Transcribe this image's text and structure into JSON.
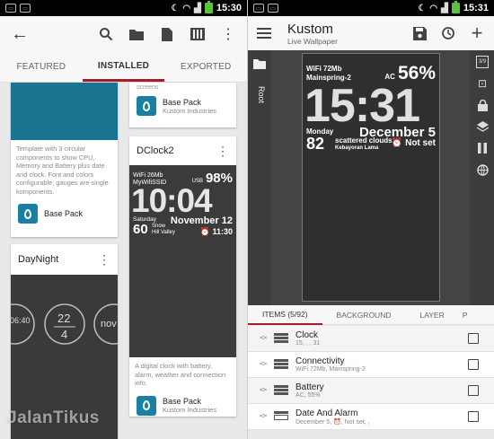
{
  "left": {
    "statusbar": {
      "time": "15:30",
      "battery_color": "#5cc13c"
    },
    "tabs": [
      "FEATURED",
      "INSTALLED",
      "EXPORTED"
    ],
    "cards": {
      "top_left_desc": "Template with 3 circular components to show CPU, Memory and Battery plus date and clock. Font and colors configurable, gauges are single komponents.",
      "top_left_pack": "Base Pack",
      "top_right_partial": "screens",
      "top_right_pack": "Base Pack",
      "top_right_pack_sub": "Kustom Industries",
      "dclock_title": "DClock2",
      "dclock_preview": {
        "wifi": "WiFi 26Mb",
        "ssid": "MyWifiSSID",
        "usb": "USB",
        "batt": "98%",
        "time": "10:04",
        "day": "Saturday",
        "date": "November 12",
        "temp": "60",
        "cond": "Snow",
        "place": "Hill Valley",
        "alarm": "⏰ 11:30"
      },
      "dclock_desc": "A digital clock with battery, alarm, weather and connection info.",
      "dclock_pack": "Base Pack",
      "dclock_pack_sub": "Kustom Industries",
      "daynight_title": "DayNight",
      "daynight_preview": {
        "a": "06:40",
        "b": "22",
        "c": "4",
        "d": "nov"
      }
    }
  },
  "right": {
    "statusbar": {
      "time": "15:31"
    },
    "title": "Kustom",
    "subtitle": "Live Wallpaper",
    "root_label": "Root",
    "preview": {
      "wifi": "WiFi 72Mb",
      "ssid": "Mainspring-2",
      "ac": "AC",
      "batt": "56%",
      "time": "15:31",
      "day": "Monday",
      "date": "December 5",
      "temp": "82",
      "cond": "scattered clouds",
      "place": "Kebayoran Lama",
      "notset": "⏰ Not set"
    },
    "tabs": [
      "ITEMS (5/92)",
      "BACKGROUND",
      "LAYER",
      "P"
    ],
    "items": [
      {
        "title": "Clock",
        "sub": "15, , , 31"
      },
      {
        "title": "Connectivity",
        "sub": "WiFi 72Mb, Mainspring-2"
      },
      {
        "title": "Battery",
        "sub": "AC, 55%"
      },
      {
        "title": "Date And Alarm",
        "sub": "December 5, ⏰, Not set, ,"
      }
    ],
    "icons": [
      "theme-icon",
      "crop-icon",
      "lock-icon",
      "layers-icon",
      "pause-icon",
      "globe-icon"
    ]
  },
  "watermark": "JalanTikus",
  "accent": "#a51c2a",
  "teal": "#1a7390"
}
